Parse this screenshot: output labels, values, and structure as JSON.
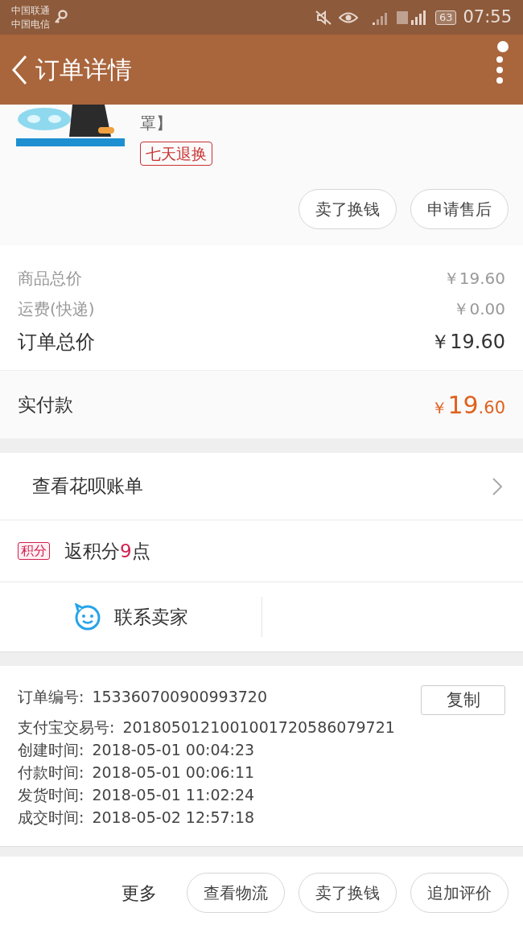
{
  "status_bar": {
    "carriers": [
      "中国联通",
      "中国电信"
    ],
    "battery": "63",
    "time": "07:55"
  },
  "header": {
    "title": "订单详情"
  },
  "product": {
    "title_visible": "罩】",
    "badge": "七天退换",
    "actions": [
      "卖了换钱",
      "申请售后"
    ]
  },
  "prices": [
    {
      "label": "商品总价",
      "value": "￥19.60",
      "kind": "minor"
    },
    {
      "label": "运费(快递)",
      "value": "￥0.00",
      "kind": "minor"
    },
    {
      "label": "订单总价",
      "value": "￥19.60",
      "kind": "major"
    }
  ],
  "payment": {
    "label": "实付款",
    "currency": "￥",
    "integer": "19",
    "decimal": ".60"
  },
  "huabei": {
    "label": "查看花呗账单"
  },
  "points": {
    "tag": "积分",
    "prefix": "返积分",
    "count": "9",
    "suffix": "点"
  },
  "contact": {
    "label": "联系卖家"
  },
  "order_info": {
    "copy_button": "复制",
    "rows": [
      {
        "label": "订单编号:",
        "value": "153360700900993720"
      },
      {
        "label": "支付宝交易号:",
        "value": "2018050121001001720586079721"
      },
      {
        "label": "创建时间:",
        "value": "2018-05-01 00:04:23"
      },
      {
        "label": "付款时间:",
        "value": "2018-05-01 00:06:11"
      },
      {
        "label": "发货时间:",
        "value": "2018-05-01 11:02:24"
      },
      {
        "label": "成交时间:",
        "value": "2018-05-02 12:57:18"
      }
    ]
  },
  "bottom_bar": {
    "more": "更多",
    "buttons": [
      "查看物流",
      "卖了换钱",
      "追加评价"
    ]
  }
}
